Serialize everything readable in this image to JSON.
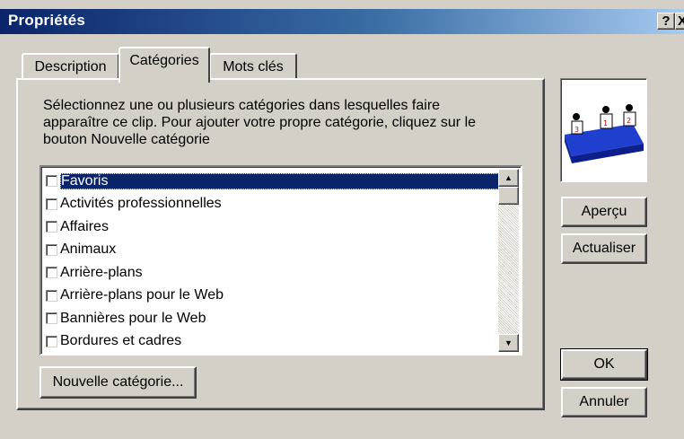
{
  "window": {
    "title": "Propriétés",
    "help_glyph": "?",
    "close_glyph": "X"
  },
  "tabs": [
    {
      "label": "Description",
      "selected": false
    },
    {
      "label": "Catégories",
      "selected": true
    },
    {
      "label": "Mots clés",
      "selected": false
    }
  ],
  "instructions": "Sélectionnez une ou plusieurs catégories dans lesquelles faire\napparaître ce clip. Pour ajouter votre propre catégorie, cliquez sur le\nbouton Nouvelle catégorie",
  "categories": [
    {
      "label": "Favoris",
      "checked": false,
      "selected": true
    },
    {
      "label": "Activités professionnelles",
      "checked": false,
      "selected": false
    },
    {
      "label": "Affaires",
      "checked": false,
      "selected": false
    },
    {
      "label": "Animaux",
      "checked": false,
      "selected": false
    },
    {
      "label": "Arrière-plans",
      "checked": false,
      "selected": false
    },
    {
      "label": "Arrière-plans pour le Web",
      "checked": false,
      "selected": false
    },
    {
      "label": "Bannières pour le Web",
      "checked": false,
      "selected": false
    },
    {
      "label": "Bordures et cadres",
      "checked": false,
      "selected": false
    }
  ],
  "buttons": {
    "new_category": "Nouvelle catégorie...",
    "preview": "Aperçu",
    "refresh": "Actualiser",
    "ok": "OK",
    "cancel": "Annuler"
  },
  "preview_image": {
    "depicts": "podium-clipart",
    "podium_labels": [
      "3",
      "1",
      "2"
    ]
  },
  "colors": {
    "titlebar_start": "#0a246a",
    "titlebar_end": "#a6caf0",
    "selection": "#0a246a",
    "face": "#d4d0c8",
    "podium": "#1f3fcf"
  }
}
